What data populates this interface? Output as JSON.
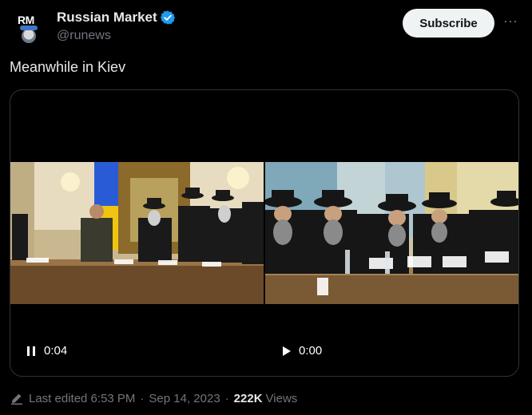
{
  "author": {
    "avatar_text": "RM",
    "name": "Russian Market",
    "handle": "@runews",
    "verified": true
  },
  "actions": {
    "subscribe_label": "Subscribe",
    "more_label": "···"
  },
  "tweet": {
    "text": "Meanwhile in Kiev"
  },
  "media": {
    "videos": [
      {
        "time": "0:04",
        "state": "playing",
        "control_icon": "pause-icon"
      },
      {
        "time": "0:00",
        "state": "paused",
        "control_icon": "play-icon"
      }
    ]
  },
  "footer": {
    "edited_label": "Last edited 6:53 PM",
    "separator": "·",
    "date": "Sep 14, 2023",
    "views_count": "222K",
    "views_label": "Views"
  },
  "colors": {
    "background": "#000000",
    "text_primary": "#e7e9ea",
    "text_secondary": "#71767b",
    "verified_blue": "#1d9bf0",
    "subscribe_bg": "#eff3f4",
    "border": "#2f3336"
  }
}
